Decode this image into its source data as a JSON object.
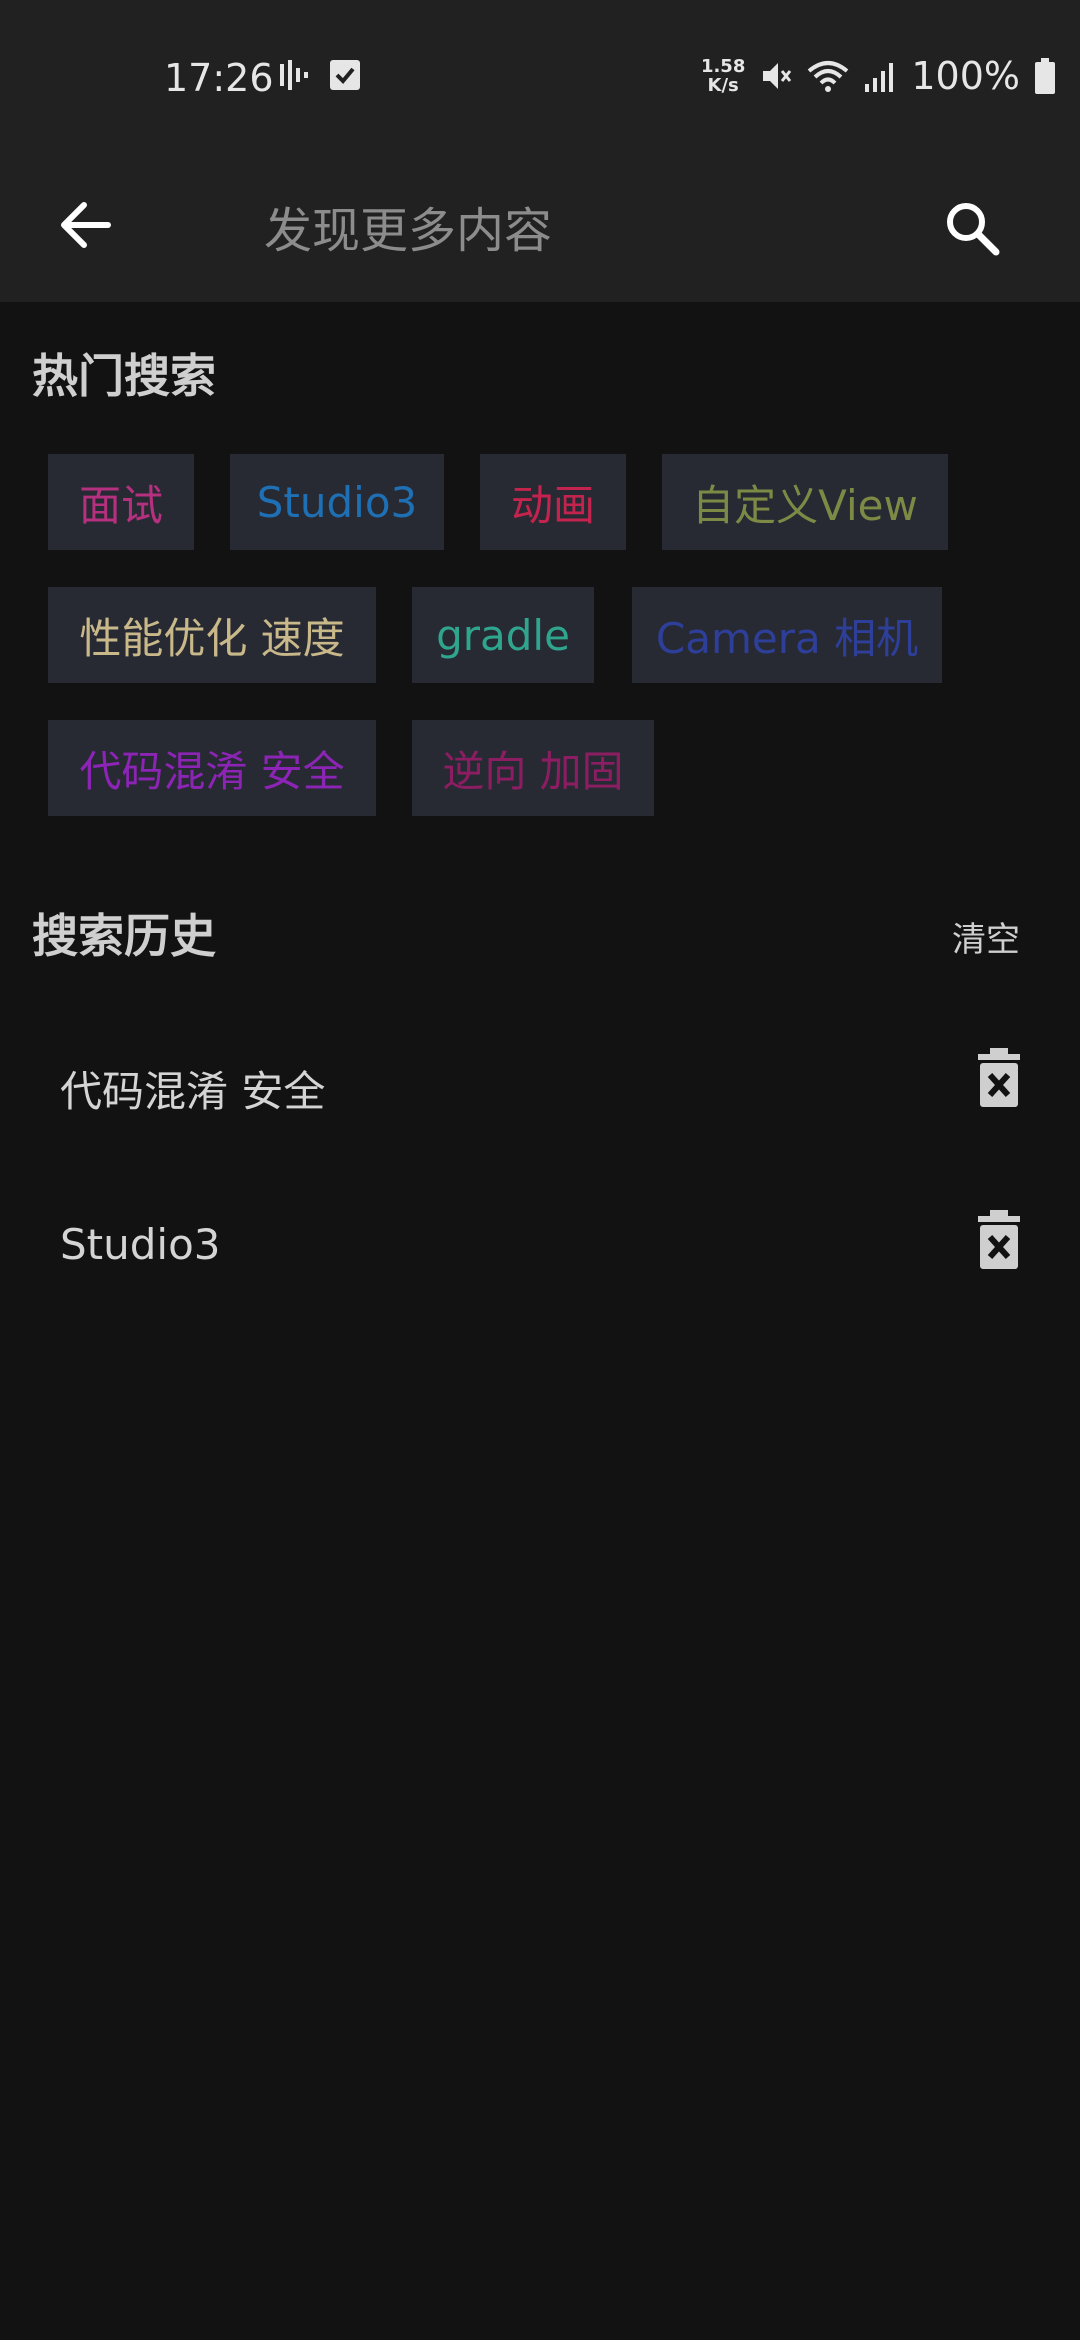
{
  "status_bar": {
    "time": "17:26",
    "net_speed_value": "1.58",
    "net_speed_unit": "K/s",
    "battery": "100%"
  },
  "toolbar": {
    "search_placeholder": "发现更多内容"
  },
  "hot_search": {
    "title": "热门搜索",
    "tags": [
      {
        "label": "面试",
        "color": "#b5307f"
      },
      {
        "label": "Studio3",
        "color": "#1e6fb3"
      },
      {
        "label": "动画",
        "color": "#c4234e"
      },
      {
        "label": "自定义View",
        "color": "#7d8a45"
      },
      {
        "label": "性能优化 速度",
        "color": "#c9b98a"
      },
      {
        "label": "gradle",
        "color": "#2fa58e"
      },
      {
        "label": "Camera 相机",
        "color": "#2e3f9a"
      },
      {
        "label": "代码混淆 安全",
        "color": "#8c24b5"
      },
      {
        "label": "逆向 加固",
        "color": "#8c1d63"
      }
    ]
  },
  "search_history": {
    "title": "搜索历史",
    "clear_label": "清空",
    "items": [
      {
        "label": "代码混淆 安全"
      },
      {
        "label": "Studio3"
      }
    ]
  }
}
